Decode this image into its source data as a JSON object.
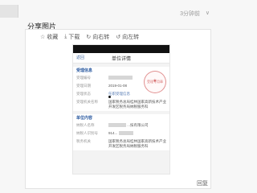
{
  "header": {
    "time": "3分钟前",
    "caret": "∨",
    "title": "分享图片"
  },
  "toolbar": {
    "items": [
      {
        "icon": "☆",
        "label": "收藏"
      },
      {
        "icon": "⤓",
        "label": "下载"
      },
      {
        "icon": "↻",
        "label": "向右转"
      },
      {
        "icon": "↺",
        "label": "向左转"
      }
    ]
  },
  "phone": {
    "nav": {
      "back": "返回",
      "title": "单位详情"
    },
    "section1": {
      "title": "受理信息",
      "rows": [
        {
          "k": "受理编号",
          "v": ""
        },
        {
          "k": "受理日期",
          "v": "2019-01-08"
        },
        {
          "k": "受理状态",
          "v": "任职受理信息"
        },
        {
          "k": "受理机关名称",
          "v": "国家税务总局桂林国家高新技术产业开发区税务局纳税服务科"
        }
      ],
      "seal": "受理专用章"
    },
    "section2": {
      "title": "单位内容",
      "rows": [
        {
          "k": "纳税人名称",
          "v": "...技有限公司"
        },
        {
          "k": "纳税人识别号",
          "v": "914..."
        },
        {
          "k": "税务机关",
          "v": "国家税务总局桂林国家高新技术产业开发区税务局纳税服务科"
        }
      ]
    }
  },
  "footer": {
    "label": "回复"
  }
}
